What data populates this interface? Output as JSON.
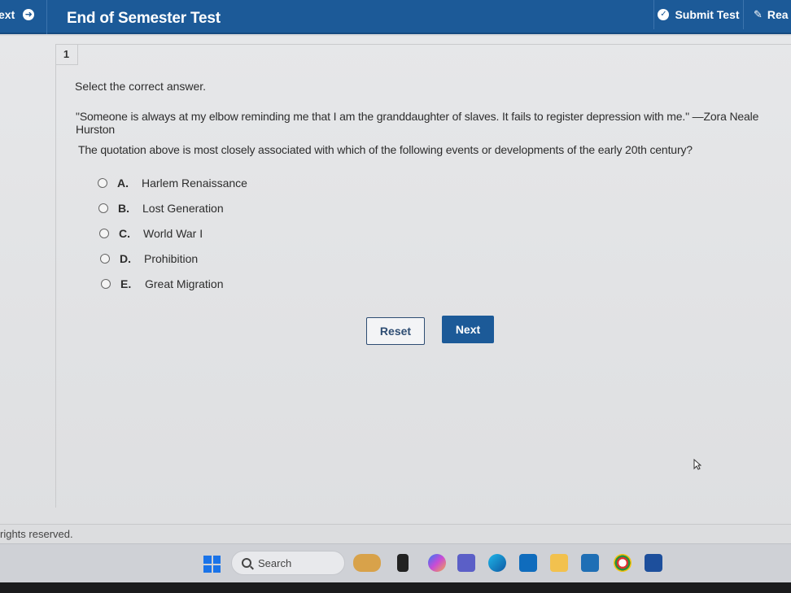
{
  "header": {
    "next_label": "ext",
    "title": "End of Semester Test",
    "submit_label": "Submit Test",
    "read_label": "Rea"
  },
  "question": {
    "number": "1",
    "instruction": "Select the correct answer.",
    "quote": "\"Someone is always at my elbow reminding me that I am the granddaughter of slaves. It fails to register depression with me.\" —Zora Neale Hurston",
    "stem": "The quotation above is most closely associated with which of the following events or developments of the early 20th century?",
    "options": [
      {
        "letter": "A.",
        "text": "Harlem Renaissance"
      },
      {
        "letter": "B.",
        "text": "Lost Generation"
      },
      {
        "letter": "C.",
        "text": "World War I"
      },
      {
        "letter": "D.",
        "text": "Prohibition"
      },
      {
        "letter": "E.",
        "text": "Great Migration"
      }
    ]
  },
  "buttons": {
    "reset": "Reset",
    "next": "Next"
  },
  "footer": {
    "rights": "rights reserved."
  },
  "taskbar": {
    "search_label": "Search"
  },
  "colors": {
    "header_bg": "#1c5a98",
    "page_bg": "#e2e3e5"
  }
}
